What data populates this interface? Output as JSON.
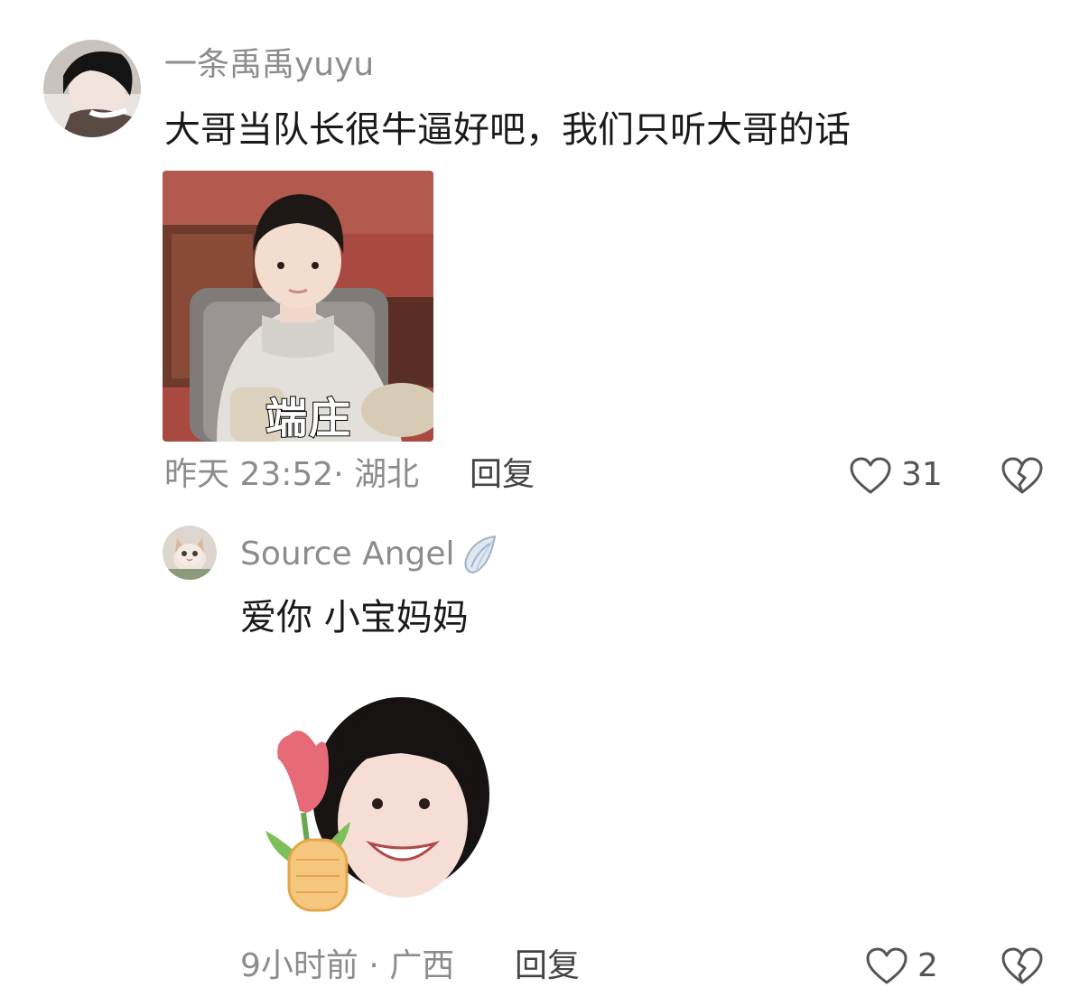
{
  "comments": [
    {
      "username": "一条禹禹yuyu",
      "text": "大哥当队长很牛逼好吧，我们只听大哥的话",
      "sticker_caption": "端庄",
      "meta": "昨天 23:52· 湖北",
      "reply_label": "回复",
      "like_count": "31",
      "icons": {
        "like": "heart-outline-icon",
        "dislike": "broken-heart-icon"
      }
    },
    {
      "username": "Source Angel",
      "text": "爱你 小宝妈妈",
      "meta": "9小时前 · 广西",
      "reply_label": "回复",
      "like_count": "2",
      "icons": {
        "badge": "angel-wing-icon",
        "like": "heart-outline-icon",
        "dislike": "broken-heart-icon"
      }
    }
  ]
}
